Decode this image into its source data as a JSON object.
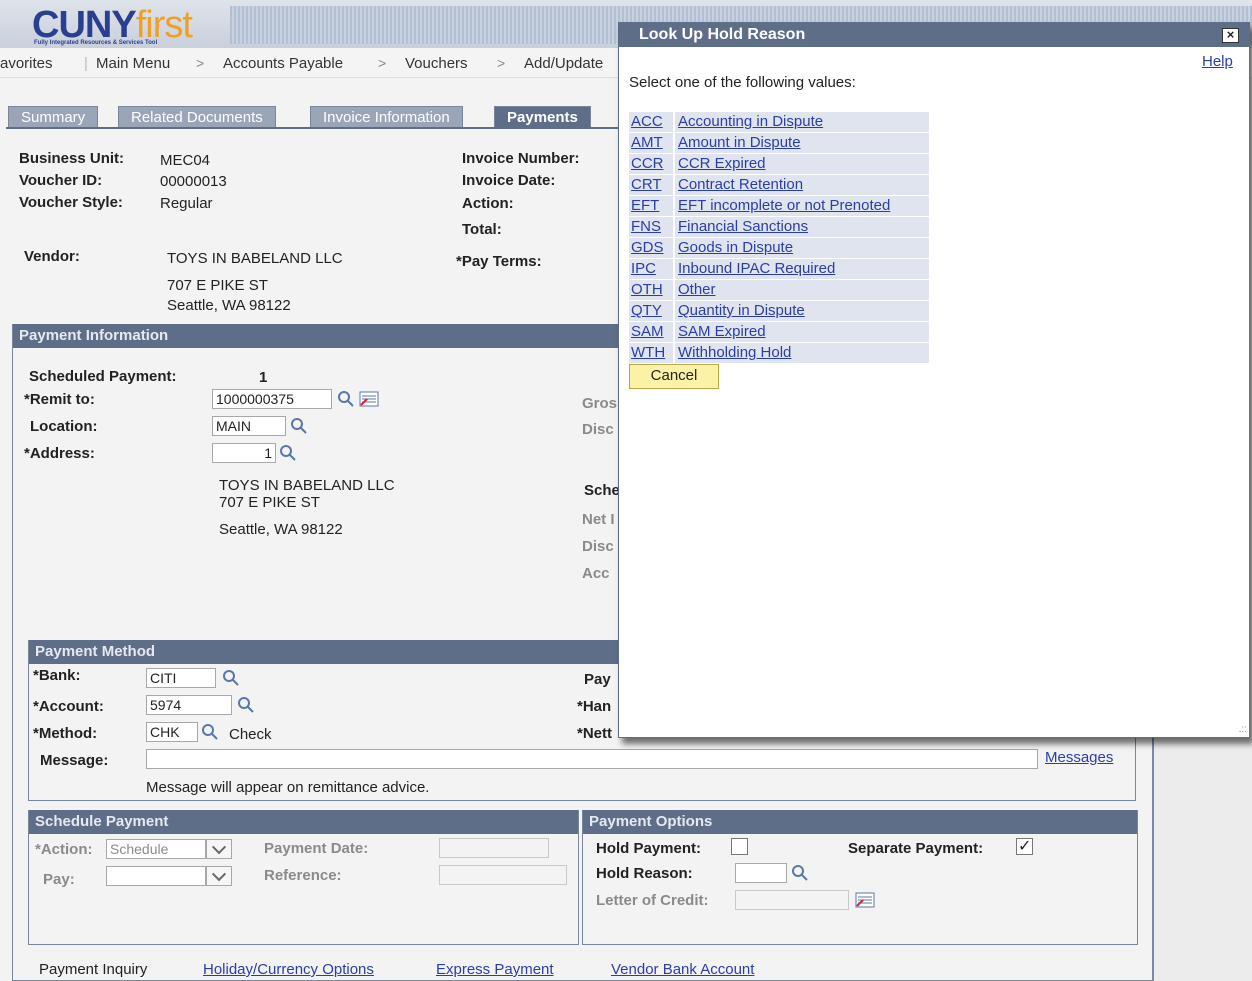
{
  "header": {
    "logo_main": "CUNY",
    "logo_accent": "first",
    "logo_sub": "Fully Integrated Resources & Services Tool",
    "nav": [
      "avorites",
      "Main Menu",
      "Accounts Payable",
      "Vouchers",
      "Add/Update"
    ],
    "nav_sep": ">"
  },
  "tabs": [
    "Summary",
    "Related Documents",
    "Invoice Information",
    "Payments"
  ],
  "summary": {
    "business_unit_label": "Business Unit:",
    "business_unit": "MEC04",
    "voucher_id_label": "Voucher ID:",
    "voucher_id": "00000013",
    "voucher_style_label": "Voucher Style:",
    "voucher_style": "Regular",
    "invoice_number_label": "Invoice Number:",
    "invoice_date_label": "Invoice Date:",
    "action_label": "Action:",
    "total_label": "Total:",
    "vendor_label": "Vendor:",
    "vendor_name": "TOYS IN BABELAND LLC",
    "vendor_addr1": "707 E PIKE ST",
    "vendor_addr2": "Seattle, WA  98122",
    "pay_terms_label": "*Pay Terms:"
  },
  "payment_info": {
    "header": "Payment Information",
    "scheduled_payment_label": "Scheduled Payment:",
    "scheduled_payment": "1",
    "remit_to_label": "*Remit to:",
    "remit_to": "1000000375",
    "location_label": "Location:",
    "location": "MAIN",
    "address_label": "*Address:",
    "address": "1",
    "addr_name": "TOYS IN BABELAND LLC",
    "addr_line1": "707 E PIKE ST",
    "addr_line2": "Seattle, WA  98122",
    "gross_label": "Gros",
    "disc_label": "Disc",
    "sched_label": "Sche",
    "net_label": "Net I",
    "disc2_label": "Disc",
    "acct_label": "Acc"
  },
  "payment_method": {
    "header": "Payment Method",
    "bank_label": "*Bank:",
    "bank": "CITI",
    "account_label": "*Account:",
    "account": "5974",
    "method_label": "*Method:",
    "method": "CHK",
    "method_desc": "Check",
    "message_label": "Message:",
    "message_value": "",
    "messages_link": "Messages",
    "message_note": "Message will appear on remittance advice.",
    "pay_label": "Pay",
    "han_label": "*Han",
    "nett_label": "*Nett"
  },
  "schedule_payment": {
    "header": "Schedule Payment",
    "action_label": "*Action:",
    "action_value": "Schedule",
    "pay_label": "Pay:",
    "pay_value": "",
    "payment_date_label": "Payment Date:",
    "payment_date": "",
    "reference_label": "Reference:",
    "reference": ""
  },
  "payment_options": {
    "header": "Payment Options",
    "hold_payment_label": "Hold Payment:",
    "hold_payment": false,
    "separate_payment_label": "Separate Payment:",
    "separate_payment": true,
    "hold_reason_label": "Hold Reason:",
    "hold_reason": "",
    "letter_of_credit_label": "Letter of Credit:",
    "letter_of_credit": ""
  },
  "footer_links": {
    "payment_inquiry": "Payment Inquiry",
    "holiday_currency": "Holiday/Currency Options",
    "express_payment": "Express Payment",
    "vendor_bank_account": "Vendor Bank Account"
  },
  "modal": {
    "title": "Look Up Hold Reason",
    "close": "×",
    "help": "Help",
    "instruction": "Select one of the following values:",
    "rows": [
      {
        "code": "ACC",
        "desc": "Accounting in Dispute"
      },
      {
        "code": "AMT",
        "desc": "Amount in Dispute"
      },
      {
        "code": "CCR",
        "desc": "CCR Expired"
      },
      {
        "code": "CRT",
        "desc": "Contract Retention"
      },
      {
        "code": "EFT",
        "desc": "EFT incomplete or not Prenoted"
      },
      {
        "code": "FNS",
        "desc": "Financial Sanctions"
      },
      {
        "code": "GDS",
        "desc": "Goods in Dispute"
      },
      {
        "code": "IPC",
        "desc": "Inbound IPAC Required"
      },
      {
        "code": "OTH",
        "desc": "Other"
      },
      {
        "code": "QTY",
        "desc": "Quantity in Dispute"
      },
      {
        "code": "SAM",
        "desc": "SAM Expired"
      },
      {
        "code": "WTH",
        "desc": "Withholding Hold"
      }
    ],
    "cancel": "Cancel"
  },
  "colors": {
    "section_header": "#5f6e88",
    "link": "#2a3ea8",
    "cancel_button": "#fbf2a6"
  }
}
